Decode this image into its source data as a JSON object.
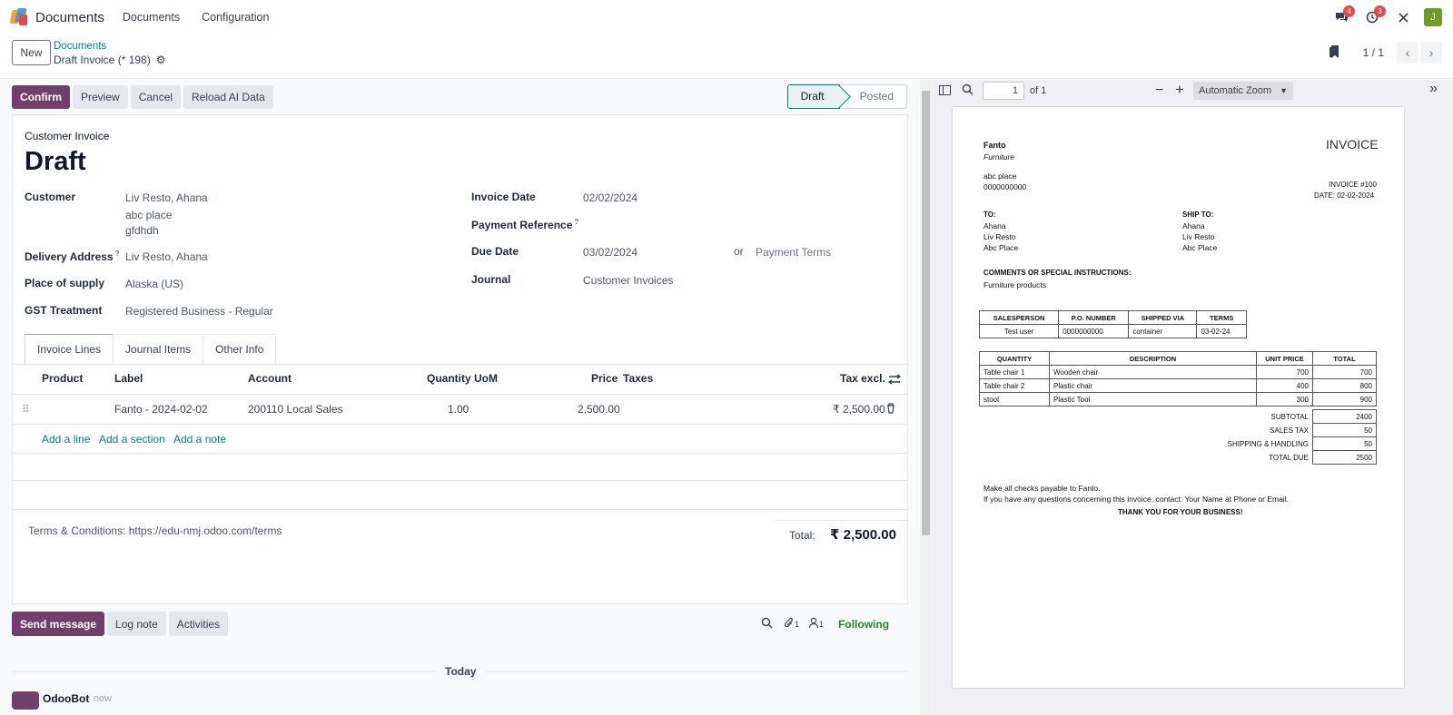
{
  "navbar": {
    "app_name": "Documents",
    "menu": [
      "Documents",
      "Configuration"
    ],
    "messages_badge": "4",
    "activities_badge": "3",
    "user_initial": "J"
  },
  "control": {
    "new_label": "New",
    "breadcrumb": "Documents",
    "record_title": "Draft Invoice (* 198)",
    "pager": "1 / 1"
  },
  "actions": {
    "confirm": "Confirm",
    "preview": "Preview",
    "cancel": "Cancel",
    "reload": "Reload AI Data"
  },
  "status": {
    "draft": "Draft",
    "posted": "Posted"
  },
  "form": {
    "type_label": "Customer Invoice",
    "state_title": "Draft",
    "customer_label": "Customer",
    "customer_name": "Liv Resto, Ahana",
    "customer_addr1": "abc place",
    "customer_addr2": "gfdhdh",
    "delivery_label": "Delivery Address",
    "delivery_value": "Liv Resto, Ahana",
    "supply_label": "Place of supply",
    "supply_value": "Alaska (US)",
    "gst_label": "GST Treatment",
    "gst_value": "Registered Business - Regular",
    "invoice_date_label": "Invoice Date",
    "invoice_date_value": "02/02/2024",
    "payref_label": "Payment Reference",
    "due_label": "Due Date",
    "due_value": "03/02/2024",
    "or": "or",
    "payment_terms_placeholder": "Payment Terms",
    "journal_label": "Journal",
    "journal_value": "Customer Invoices",
    "help": "?"
  },
  "tabs": [
    "Invoice Lines",
    "Journal Items",
    "Other Info"
  ],
  "lines": {
    "headers": {
      "product": "Product",
      "label": "Label",
      "account": "Account",
      "quantity": "Quantity",
      "uom": "UoM",
      "price": "Price",
      "taxes": "Taxes",
      "tax_excl": "Tax excl."
    },
    "row": {
      "label": "Fanto - 2024-02-02",
      "account": "200110 Local Sales",
      "quantity": "1.00",
      "price": "2,500.00",
      "subtotal": "₹ 2,500.00"
    },
    "add_line": "Add a line",
    "add_section": "Add a section",
    "add_note": "Add a note"
  },
  "footer": {
    "terms": "Terms & Conditions: https://edu-nmj.odoo.com/terms",
    "total_label": "Total:",
    "total_value": "₹ 2,500.00"
  },
  "chatter": {
    "send": "Send message",
    "log": "Log note",
    "activities": "Activities",
    "attachments": "1",
    "followers": "1",
    "following": "Following",
    "today": "Today",
    "author": "OdooBot",
    "time": "- now"
  },
  "pdf": {
    "page": "1",
    "of": "of 1",
    "zoom": "Automatic Zoom",
    "company": "Fanto",
    "company_sub": "Furniture",
    "addr1": "abc place",
    "addr2": "0000000000",
    "invoice_title": "INVOICE",
    "invoice_no": "INVOICE #100",
    "invoice_date": "DATE: 02-02-2024",
    "to_label": "TO:",
    "to_lines": [
      "Ahana",
      "Liv Resto",
      "Abc Place"
    ],
    "shipto_label": "SHIP TO:",
    "shipto_lines": [
      "Ahana",
      "Liv Resto",
      "Abc Place"
    ],
    "comments_label": "COMMENTS OR SPECIAL INSTRUCTIONS:",
    "comments": "Furniture products",
    "meta_headers": [
      "SALESPERSON",
      "P.O. NUMBER",
      "SHIPPED VIA",
      "TERMS"
    ],
    "meta_values": [
      "Test user",
      "0000000000",
      "container",
      "03-02-24"
    ],
    "item_headers": [
      "QUANTITY",
      "DESCRIPTION",
      "UNIT PRICE",
      "TOTAL"
    ],
    "items": [
      [
        "Table chair 1",
        "Wooden chair",
        "700",
        "700"
      ],
      [
        "Table chair 2",
        "Plastic chair",
        "400",
        "800"
      ],
      [
        "stool",
        "Plastic Tool",
        "300",
        "900"
      ]
    ],
    "subtotal_label": "SUBTOTAL",
    "subtotal": "2400",
    "tax_label": "SALES TAX",
    "tax": "50",
    "shipping_label": "SHIPPING & HANDLING",
    "shipping": "50",
    "due_label": "TOTAL DUE",
    "due": "2500",
    "note1": "Make all checks payable to Fanto.",
    "note2": "If you have any questions concerning this invoice, contact: Your Name at Phone or Email.",
    "thanks": "THANK YOU FOR YOUR BUSINESS!"
  }
}
